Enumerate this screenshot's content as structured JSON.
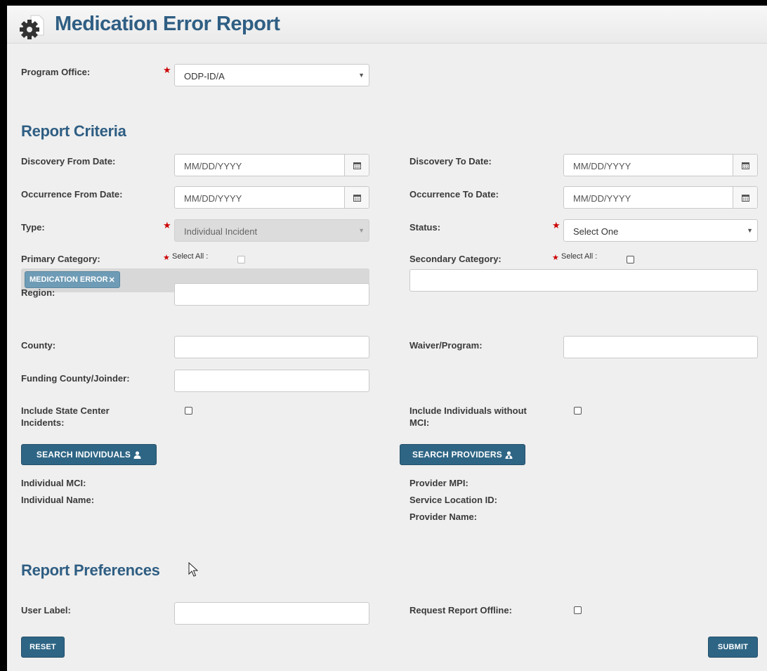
{
  "header": {
    "title": "Medication Error Report",
    "icon": "gear-icon"
  },
  "program_office": {
    "label": "Program Office:",
    "value": "ODP-ID/A"
  },
  "report_criteria": {
    "heading": "Report Criteria",
    "discovery_from": {
      "label": "Discovery From Date:",
      "placeholder": "MM/DD/YYYY"
    },
    "discovery_to": {
      "label": "Discovery To Date:",
      "placeholder": "MM/DD/YYYY"
    },
    "occurrence_from": {
      "label": "Occurrence From Date:",
      "placeholder": "MM/DD/YYYY"
    },
    "occurrence_to": {
      "label": "Occurrence To Date:",
      "placeholder": "MM/DD/YYYY"
    },
    "type": {
      "label": "Type:",
      "value": "Individual Incident"
    },
    "status": {
      "label": "Status:",
      "value": "Select One"
    },
    "primary_category": {
      "label": "Primary Category:",
      "select_all": "Select All :",
      "tag": "MEDICATION ERROR"
    },
    "secondary_category": {
      "label": "Secondary Category:",
      "select_all": "Select All :"
    },
    "region": {
      "label": "Region:"
    },
    "county": {
      "label": "County:"
    },
    "waiver_program": {
      "label": "Waiver/Program:"
    },
    "funding_county": {
      "label": "Funding County/Joinder:"
    },
    "state_center": {
      "label_line1": "Include State Center",
      "label_line2": "Incidents:"
    },
    "without_mci": {
      "label_line1": "Include Individuals without",
      "label_line2": "MCI:"
    },
    "search_individuals": "SEARCH INDIVIDUALS",
    "search_providers": "SEARCH PROVIDERS",
    "individual_mci": "Individual MCI:",
    "individual_name": "Individual Name:",
    "provider_mpi": "Provider MPI:",
    "service_location": "Service Location ID:",
    "provider_name": "Provider Name:"
  },
  "report_preferences": {
    "heading": "Report Preferences",
    "user_label": "User Label:",
    "request_offline": "Request Report Offline:"
  },
  "buttons": {
    "reset": "RESET",
    "submit": "SUBMIT"
  },
  "colors": {
    "accent": "#2f5e83",
    "button": "#2e6585",
    "required": "#cc0000"
  }
}
